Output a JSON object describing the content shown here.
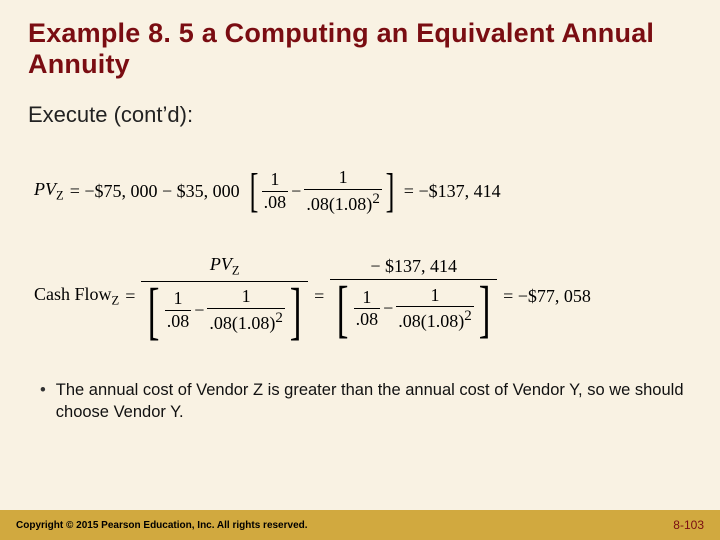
{
  "title": "Example 8. 5 a Computing an Equivalent Annual Annuity",
  "subhead": "Execute (cont’d):",
  "eq1": {
    "lhs_var": "PV",
    "lhs_sub": "Z",
    "pre": "= −$75, 000 − $35, 000",
    "frac1_num": "1",
    "frac1_den": ".08",
    "minus": "−",
    "frac2_num": "1",
    "frac2_den_a": ".08(1.08)",
    "frac2_den_exp": "2",
    "result": "= −$137, 414"
  },
  "eq2": {
    "lhs_label": "Cash Flow",
    "lhs_sub": "Z",
    "eq": "=",
    "top_var": "PV",
    "top_sub": "Z",
    "frac1_num": "1",
    "frac1_den": ".08",
    "minus": "−",
    "frac2_num": "1",
    "frac2_den_a": ".08(1.08)",
    "frac2_den_exp": "2",
    "mid_eq": "=",
    "top2": "− $137, 414",
    "result": "= −$77, 058"
  },
  "bullet": "The annual cost of Vendor Z is greater than the annual cost of Vendor Y, so we should choose Vendor Y.",
  "footer_left": "Copyright © 2015 Pearson Education, Inc. All rights reserved.",
  "footer_right": "8-103"
}
